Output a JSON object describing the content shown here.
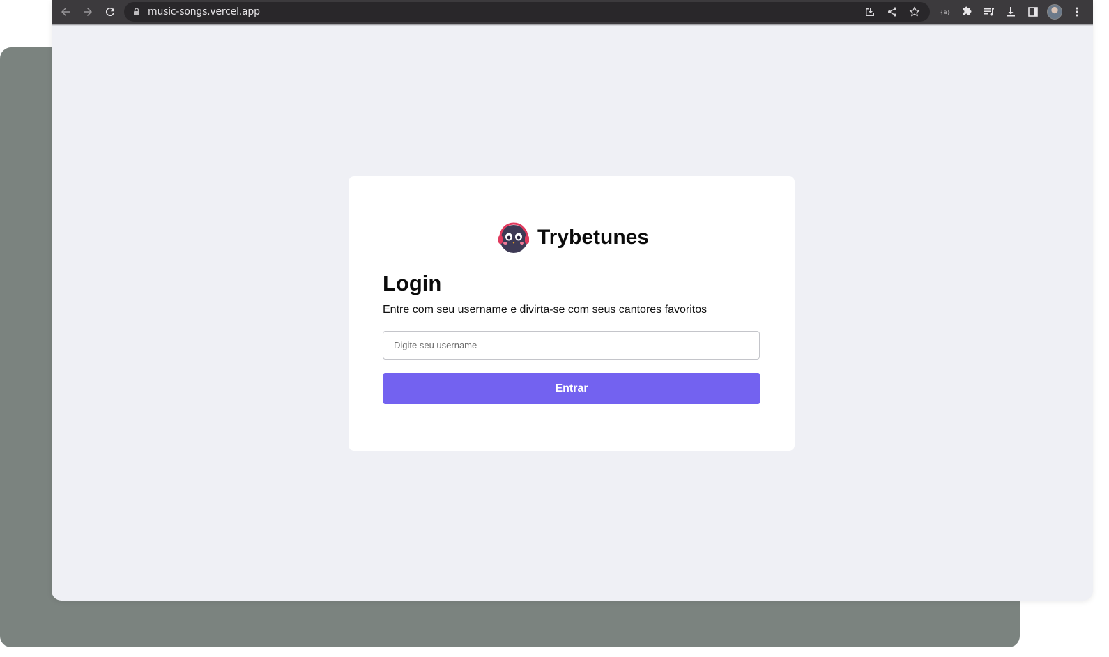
{
  "browser": {
    "url": "music-songs.vercel.app",
    "nav": {
      "back_icon": "arrow-left-icon",
      "forward_icon": "arrow-right-icon",
      "reload_icon": "reload-icon"
    },
    "omnibox_icons": [
      "install-app-icon",
      "share-icon",
      "bookmark-star-icon"
    ],
    "toolbar_icons": [
      "extension-code-icon",
      "extensions-puzzle-icon",
      "reading-list-icon",
      "downloads-icon",
      "side-panel-icon",
      "profile-avatar",
      "menu-kebab-icon"
    ]
  },
  "app": {
    "brand": "Trybetunes",
    "logo_icon": "trybetunes-mascot-logo",
    "login": {
      "title": "Login",
      "subtitle": "Entre com seu username e divirta-se com seus cantores favoritos",
      "username_placeholder": "Digite seu username",
      "username_value": "",
      "submit_label": "Entrar"
    }
  },
  "colors": {
    "page_background": "#eff0f5",
    "card_background": "#ffffff",
    "button": "#7362f0",
    "backdrop": "#7b837f",
    "toolbar": "#3c3a3d"
  }
}
